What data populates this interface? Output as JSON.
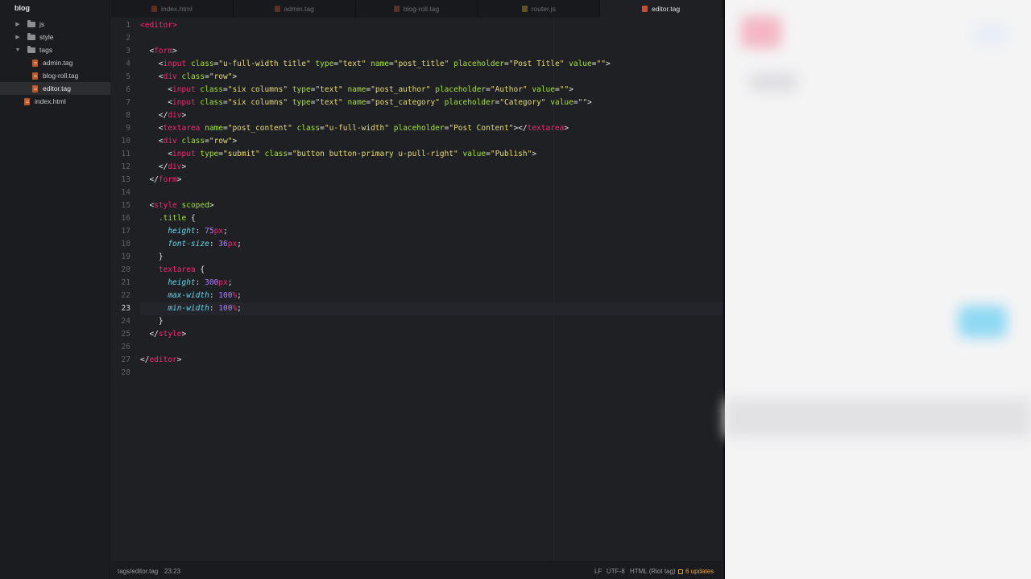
{
  "sidebar": {
    "root": "blog",
    "items": [
      {
        "label": "js",
        "type": "folder",
        "expanded": false
      },
      {
        "label": "style",
        "type": "folder",
        "expanded": false
      },
      {
        "label": "tags",
        "type": "folder",
        "expanded": true
      },
      {
        "label": "admin.tag",
        "type": "file"
      },
      {
        "label": "blog-roll.tag",
        "type": "file"
      },
      {
        "label": "editor.tag",
        "type": "file",
        "selected": true
      },
      {
        "label": "index.html",
        "type": "file"
      }
    ]
  },
  "tabs": [
    {
      "label": "index.html",
      "icon": "html-file-icon"
    },
    {
      "label": "admin.tag",
      "icon": "tag-file-icon"
    },
    {
      "label": "blog-roll.tag",
      "icon": "tag-file-icon"
    },
    {
      "label": "router.js",
      "icon": "js-file-icon"
    },
    {
      "label": "editor.tag",
      "icon": "tag-file-icon",
      "active": true
    }
  ],
  "editor": {
    "current_line": 23,
    "line_numbers": [
      "1",
      "2",
      "3",
      "4",
      "5",
      "6",
      "7",
      "8",
      "9",
      "10",
      "11",
      "12",
      "13",
      "14",
      "15",
      "16",
      "17",
      "18",
      "19",
      "20",
      "21",
      "22",
      "23",
      "24",
      "25",
      "26",
      "27",
      "28"
    ],
    "lines": [
      [
        [
          "tag",
          "<"
        ],
        [
          "t",
          "editor"
        ],
        [
          "tag",
          ">"
        ]
      ],
      [],
      [
        [
          "p",
          "  <"
        ],
        [
          "t",
          "form"
        ],
        [
          "p",
          ">"
        ]
      ],
      [
        [
          "p",
          "    <"
        ],
        [
          "t",
          "input"
        ],
        [
          "p",
          " "
        ],
        [
          "a",
          "class"
        ],
        [
          "p",
          "="
        ],
        [
          "s",
          "\"u-full-width title\""
        ],
        [
          "p",
          " "
        ],
        [
          "a",
          "type"
        ],
        [
          "p",
          "="
        ],
        [
          "s",
          "\"text\""
        ],
        [
          "p",
          " "
        ],
        [
          "a",
          "name"
        ],
        [
          "p",
          "="
        ],
        [
          "s",
          "\"post_title\""
        ],
        [
          "p",
          " "
        ],
        [
          "a",
          "placeholder"
        ],
        [
          "p",
          "="
        ],
        [
          "s",
          "\"Post Title\""
        ],
        [
          "p",
          " "
        ],
        [
          "a",
          "value"
        ],
        [
          "p",
          "="
        ],
        [
          "s",
          "\"\""
        ],
        [
          "p",
          ">"
        ]
      ],
      [
        [
          "p",
          "    <"
        ],
        [
          "t",
          "div"
        ],
        [
          "p",
          " "
        ],
        [
          "a",
          "class"
        ],
        [
          "p",
          "="
        ],
        [
          "s",
          "\"row\""
        ],
        [
          "p",
          ">"
        ]
      ],
      [
        [
          "p",
          "      <"
        ],
        [
          "t",
          "input"
        ],
        [
          "p",
          " "
        ],
        [
          "a",
          "class"
        ],
        [
          "p",
          "="
        ],
        [
          "s",
          "\"six columns\""
        ],
        [
          "p",
          " "
        ],
        [
          "a",
          "type"
        ],
        [
          "p",
          "="
        ],
        [
          "s",
          "\"text\""
        ],
        [
          "p",
          " "
        ],
        [
          "a",
          "name"
        ],
        [
          "p",
          "="
        ],
        [
          "s",
          "\"post_author\""
        ],
        [
          "p",
          " "
        ],
        [
          "a",
          "placeholder"
        ],
        [
          "p",
          "="
        ],
        [
          "s",
          "\"Author\""
        ],
        [
          "p",
          " "
        ],
        [
          "a",
          "value"
        ],
        [
          "p",
          "="
        ],
        [
          "s",
          "\"\""
        ],
        [
          "p",
          ">"
        ]
      ],
      [
        [
          "p",
          "      <"
        ],
        [
          "t",
          "input"
        ],
        [
          "p",
          " "
        ],
        [
          "a",
          "class"
        ],
        [
          "p",
          "="
        ],
        [
          "s",
          "\"six columns\""
        ],
        [
          "p",
          " "
        ],
        [
          "a",
          "type"
        ],
        [
          "p",
          "="
        ],
        [
          "s",
          "\"text\""
        ],
        [
          "p",
          " "
        ],
        [
          "a",
          "name"
        ],
        [
          "p",
          "="
        ],
        [
          "s",
          "\"post_category\""
        ],
        [
          "p",
          " "
        ],
        [
          "a",
          "placeholder"
        ],
        [
          "p",
          "="
        ],
        [
          "s",
          "\"Category\""
        ],
        [
          "p",
          " "
        ],
        [
          "a",
          "value"
        ],
        [
          "p",
          "="
        ],
        [
          "s",
          "\"\""
        ],
        [
          "p",
          ">"
        ]
      ],
      [
        [
          "p",
          "    </"
        ],
        [
          "t",
          "div"
        ],
        [
          "p",
          ">"
        ]
      ],
      [
        [
          "p",
          "    <"
        ],
        [
          "t",
          "textarea"
        ],
        [
          "p",
          " "
        ],
        [
          "a",
          "name"
        ],
        [
          "p",
          "="
        ],
        [
          "s",
          "\"post_content\""
        ],
        [
          "p",
          " "
        ],
        [
          "a",
          "class"
        ],
        [
          "p",
          "="
        ],
        [
          "s",
          "\"u-full-width\""
        ],
        [
          "p",
          " "
        ],
        [
          "a",
          "placeholder"
        ],
        [
          "p",
          "="
        ],
        [
          "s",
          "\"Post Content\""
        ],
        [
          "p",
          "></"
        ],
        [
          "t",
          "textarea"
        ],
        [
          "p",
          ">"
        ]
      ],
      [
        [
          "p",
          "    <"
        ],
        [
          "t",
          "div"
        ],
        [
          "p",
          " "
        ],
        [
          "a",
          "class"
        ],
        [
          "p",
          "="
        ],
        [
          "s",
          "\"row\""
        ],
        [
          "p",
          ">"
        ]
      ],
      [
        [
          "p",
          "      <"
        ],
        [
          "t",
          "input"
        ],
        [
          "p",
          " "
        ],
        [
          "a",
          "type"
        ],
        [
          "p",
          "="
        ],
        [
          "s",
          "\"submit\""
        ],
        [
          "p",
          " "
        ],
        [
          "a",
          "class"
        ],
        [
          "p",
          "="
        ],
        [
          "s",
          "\"button button-primary u-pull-right\""
        ],
        [
          "p",
          " "
        ],
        [
          "a",
          "value"
        ],
        [
          "p",
          "="
        ],
        [
          "s",
          "\"Publish\""
        ],
        [
          "p",
          ">"
        ]
      ],
      [
        [
          "p",
          "    </"
        ],
        [
          "t",
          "div"
        ],
        [
          "p",
          ">"
        ]
      ],
      [
        [
          "p",
          "  </"
        ],
        [
          "t",
          "form"
        ],
        [
          "p",
          ">"
        ]
      ],
      [],
      [
        [
          "p",
          "  <"
        ],
        [
          "t",
          "style"
        ],
        [
          "p",
          " "
        ],
        [
          "a",
          "scoped"
        ],
        [
          "p",
          ">"
        ]
      ],
      [
        [
          "p",
          "    "
        ],
        [
          "sel",
          ".title"
        ],
        [
          "p",
          " {"
        ]
      ],
      [
        [
          "p",
          "      "
        ],
        [
          "k",
          "height"
        ],
        [
          "p",
          ": "
        ],
        [
          "n",
          "75"
        ],
        [
          "u",
          "px"
        ],
        [
          "p",
          ";"
        ]
      ],
      [
        [
          "p",
          "      "
        ],
        [
          "k",
          "font-size"
        ],
        [
          "p",
          ": "
        ],
        [
          "n",
          "36"
        ],
        [
          "u",
          "px"
        ],
        [
          "p",
          ";"
        ]
      ],
      [
        [
          "p",
          "    }"
        ]
      ],
      [
        [
          "p",
          "    "
        ],
        [
          "t",
          "textarea"
        ],
        [
          "p",
          " {"
        ]
      ],
      [
        [
          "p",
          "      "
        ],
        [
          "k",
          "height"
        ],
        [
          "p",
          ": "
        ],
        [
          "n",
          "300"
        ],
        [
          "u",
          "px"
        ],
        [
          "p",
          ";"
        ]
      ],
      [
        [
          "p",
          "      "
        ],
        [
          "k",
          "max-width"
        ],
        [
          "p",
          ": "
        ],
        [
          "n",
          "100"
        ],
        [
          "u",
          "%"
        ],
        [
          "p",
          ";"
        ]
      ],
      [
        [
          "p",
          "      "
        ],
        [
          "k",
          "min-width"
        ],
        [
          "p",
          ": "
        ],
        [
          "n",
          "100"
        ],
        [
          "u",
          "%"
        ],
        [
          "p",
          ";"
        ]
      ],
      [
        [
          "p",
          "    }"
        ]
      ],
      [
        [
          "p",
          "  </"
        ],
        [
          "t",
          "style"
        ],
        [
          "p",
          ">"
        ]
      ],
      [],
      [
        [
          "p",
          "</"
        ],
        [
          "t",
          "editor"
        ],
        [
          "p",
          ">"
        ]
      ],
      []
    ]
  },
  "status": {
    "path": "tags/editor.tag",
    "cursor": "23:23",
    "line_ending": "LF",
    "encoding": "UTF-8",
    "grammar": "HTML (Riot tag)",
    "updates": "6 updates"
  },
  "colors": {
    "tag": "#f92672",
    "attr": "#a6e22e",
    "string": "#e6db74",
    "property": "#66d9ef",
    "number": "#ae81ff",
    "updates": "#e7a33e"
  }
}
